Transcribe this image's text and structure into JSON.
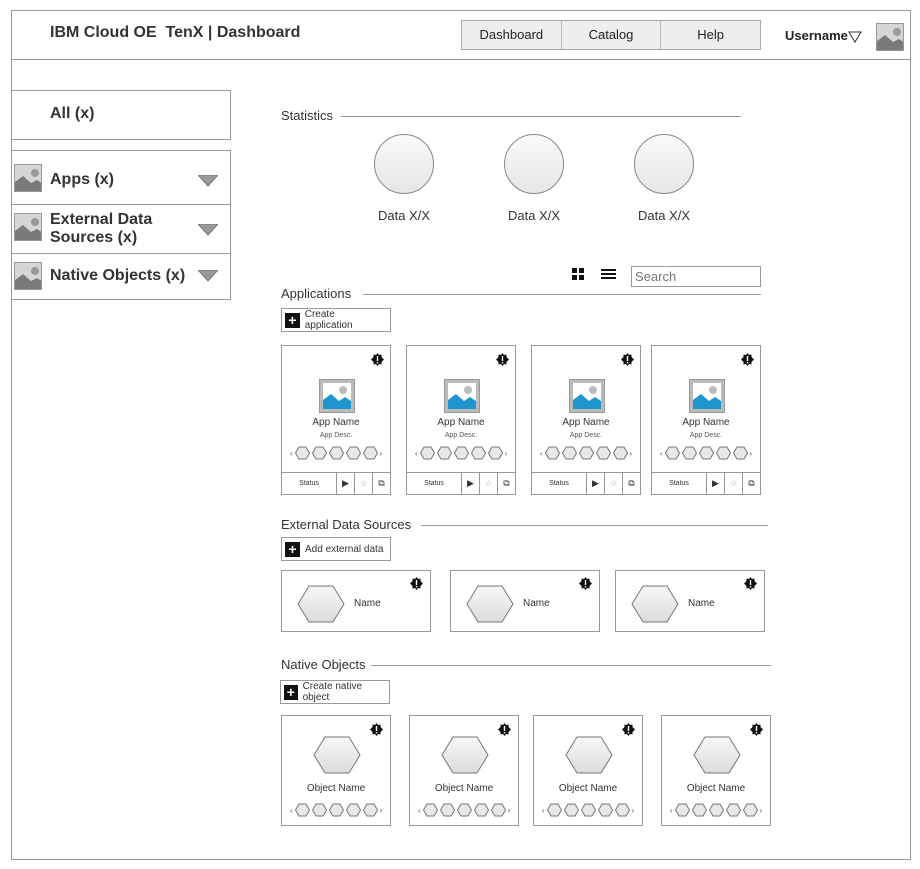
{
  "header": {
    "title": "IBM Cloud OE  TenX | Dashboard",
    "nav": [
      "Dashboard",
      "Catalog",
      "Help"
    ],
    "username": "Username"
  },
  "sidebar": {
    "all_label": "All (x)",
    "items": [
      {
        "label": "Apps (x)"
      },
      {
        "label": "External Data Sources (x)"
      },
      {
        "label": "Native Objects (x)"
      }
    ]
  },
  "statistics": {
    "title": "Statistics",
    "items": [
      "Data X/X",
      "Data X/X",
      "Data X/X"
    ]
  },
  "applications": {
    "title": "Applications",
    "search_placeholder": "Search",
    "create_label": "Create application",
    "cards": [
      {
        "name": "App Name",
        "desc": "App Desc.",
        "status": "Status"
      },
      {
        "name": "App Name",
        "desc": "App Desc.",
        "status": "Status"
      },
      {
        "name": "App Name",
        "desc": "App Desc.",
        "status": "Status"
      },
      {
        "name": "App Name",
        "desc": "App Desc.",
        "status": "Status"
      }
    ]
  },
  "external": {
    "title": "External Data Sources",
    "add_label": "Add external data",
    "cards": [
      {
        "name": "Name"
      },
      {
        "name": "Name"
      },
      {
        "name": "Name"
      }
    ]
  },
  "native": {
    "title": "Native Objects",
    "create_label": "Create native object",
    "cards": [
      {
        "name": "Object Name"
      },
      {
        "name": "Object Name"
      },
      {
        "name": "Object Name"
      },
      {
        "name": "Object Name"
      }
    ]
  }
}
